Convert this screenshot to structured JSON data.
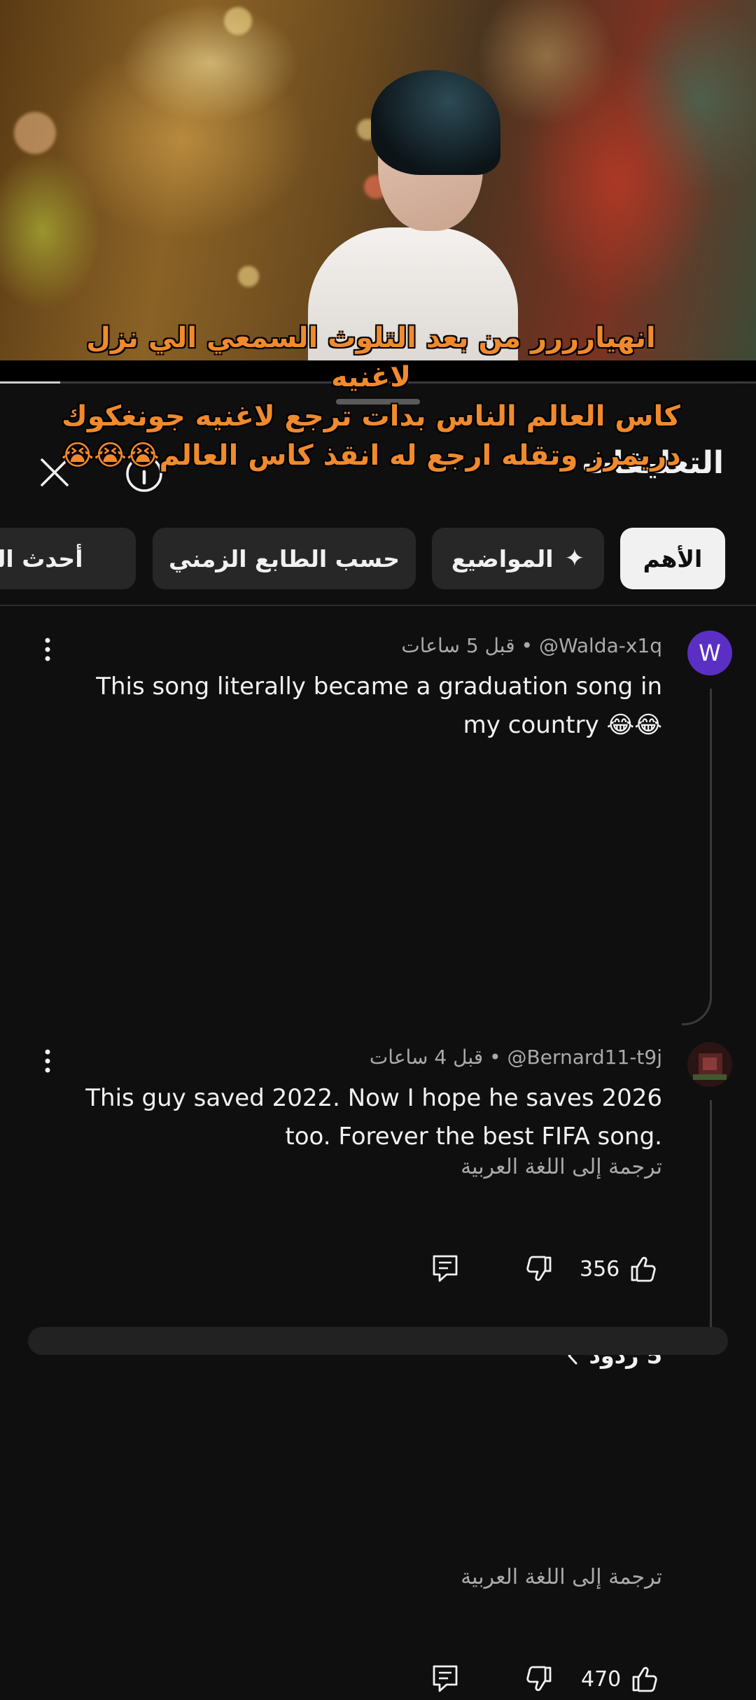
{
  "video": {
    "progress_fraction": 0.08
  },
  "caption": {
    "lines": [
      "انهيارررر من بعد التلوث السمعي الي نزل لاغنيه",
      "كاس العالم الناس بدات ترجع لاغنيه جونغكوك",
      "دريمرز وتقله ارجع له انقذ كاس العالم😭😭😭"
    ]
  },
  "sheet": {
    "title": "التعليقات",
    "close_icon": "close-icon",
    "info_icon": "info-icon"
  },
  "chips": [
    {
      "label": "الأهم",
      "active": true
    },
    {
      "label": "المواضيع",
      "icon": "sparkle-icon",
      "active": false
    },
    {
      "label": "حسب الطابع الزمني",
      "active": false
    },
    {
      "label": "أحدث التع",
      "active": false
    }
  ],
  "comments": [
    {
      "author": "@Walda-x1q",
      "time": "قبل 5 ساعات",
      "avatar_letter": "W",
      "avatar_color": "#5b2fc4",
      "text_line1": "This song literally became a graduation song in",
      "text_line2": "my country 😂😂",
      "translate": "ترجمة إلى اللغة العربية",
      "likes": "356",
      "replies": "5 ردود"
    },
    {
      "author": "@Bernard11-t9j",
      "time": "قبل 4 ساعات",
      "avatar_color": "#3a1a1a",
      "text_line1": "This guy saved 2022. Now I hope he saves 2026",
      "text_line2": "too. Forever the best FIFA song.",
      "translate": "ترجمة إلى اللغة العربية",
      "likes": "470"
    }
  ],
  "separator": "•"
}
